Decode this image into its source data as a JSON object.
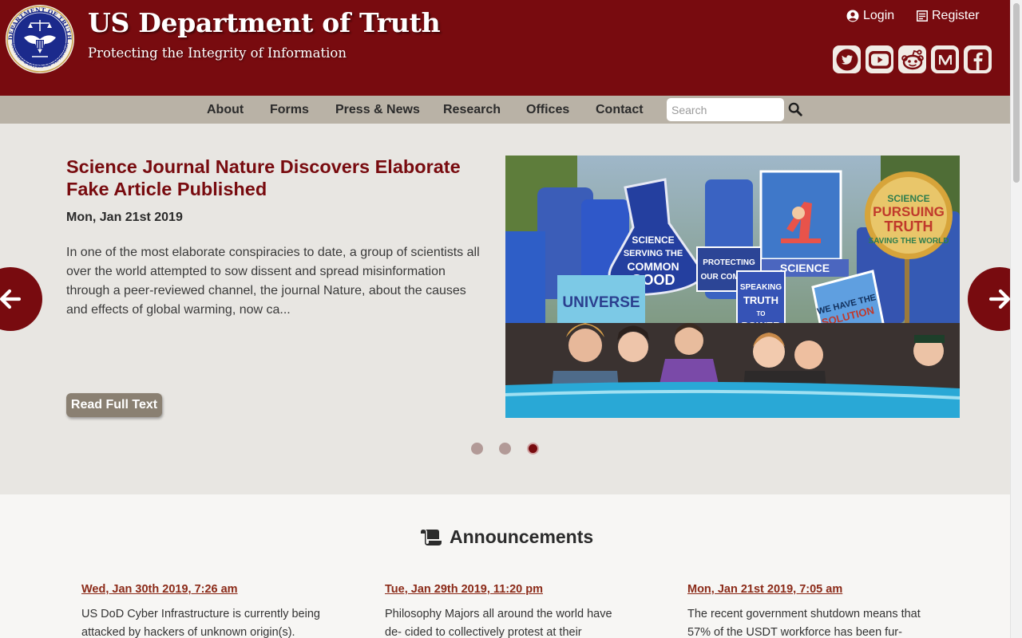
{
  "header": {
    "site_title": "US Department of Truth",
    "tagline": "Protecting the Integrity of Information",
    "seal_text": "DEPARTMENT OF TRUTH · UNITED STATES OF AMERICA",
    "login_label": "Login",
    "register_label": "Register",
    "socials": [
      "twitter-icon",
      "youtube-icon",
      "reddit-icon",
      "medium-icon",
      "facebook-icon"
    ]
  },
  "nav": {
    "items": [
      "About",
      "Forms",
      "Press & News",
      "Research",
      "Offices",
      "Contact"
    ],
    "search_placeholder": "Search"
  },
  "carousel": {
    "title": "Science Journal Nature Discovers Elaborate Fake Article Published",
    "date": "Mon, Jan 21st 2019",
    "excerpt": "In one of the most elaborate conspiracies to date, a group of scientists all over the world attempted to sow dissent and spread misinformation through a peer-reviewed channel, the journal Nature, about the causes and effects of global warming, now ca...",
    "read_button": "Read Full Text",
    "image_signs": [
      "SCIENCE SERVING THE COMMON GOOD",
      "SCIENCE PURSUING TRUTH SAVING THE WORLD",
      "SCIENTISTS SPEAKING TRUTH TO POWER",
      "WE HAVE THE SOLUTION",
      "PROTECTING OUR COMMUNITIES",
      "SCIENCE",
      "UNIVERSE"
    ],
    "dot_count": 3,
    "active_dot": 3
  },
  "announcements": {
    "title": "Announcements",
    "items": [
      {
        "date": "Wed, Jan 30th 2019, 7:26 am",
        "text": "US DoD Cyber Infrastructure is currently being attacked by hackers of unknown origin(s)."
      },
      {
        "date": "Tue, Jan 29th 2019, 11:20 pm",
        "text": "Philosophy Majors all around the world have de- cided to collectively protest at their universities'"
      },
      {
        "date": "Mon, Jan 21st 2019, 7:05 am",
        "text": "The recent government shutdown means that 57% of the USDT workforce has been fur-"
      }
    ]
  },
  "colors": {
    "brand": "#780b0f",
    "nav_bg": "#b9b2a6",
    "page_bg": "#e8e6e2",
    "link": "#8b2a18"
  }
}
